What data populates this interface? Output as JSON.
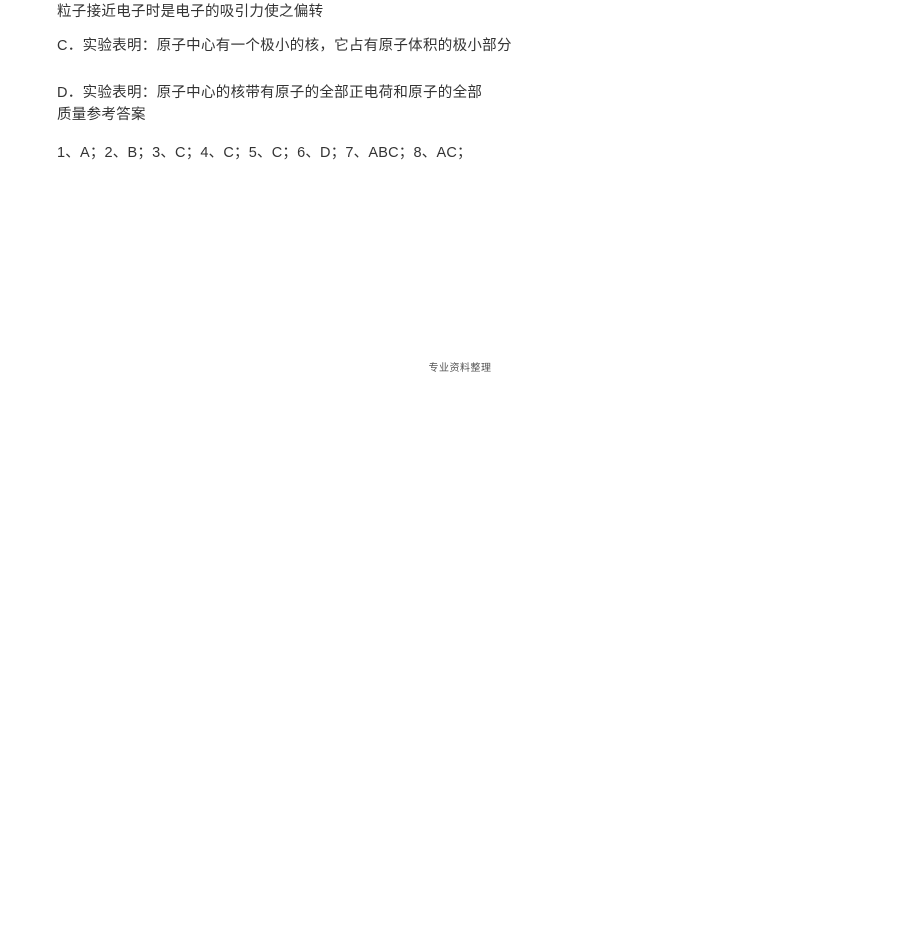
{
  "content": {
    "line_partial": "粒子接近电子时是电子的吸引力使之偏转",
    "option_c": "C．实验表明：原子中心有一个极小的核，它占有原子体积的极小部分",
    "option_d_1": "D．实验表明：原子中心的核带有原子的全部正电荷和原子的全部",
    "option_d_2": "质量参考答案",
    "answers": "1、A；2、B；3、C；4、C；5、C；6、D；7、ABC；8、AC；"
  },
  "footer": "专业资料整理"
}
